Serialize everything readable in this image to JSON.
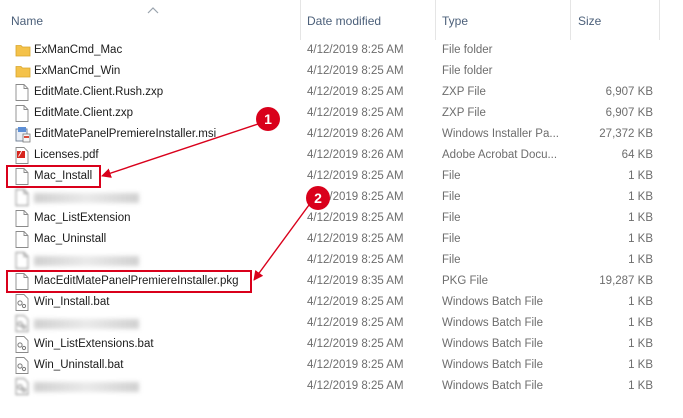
{
  "columns": {
    "name": "Name",
    "date": "Date modified",
    "type": "Type",
    "size": "Size"
  },
  "files": [
    {
      "name": "ExManCmd_Mac",
      "date": "4/12/2019 8:25 AM",
      "type": "File folder",
      "size": "",
      "icon": "folder-icon"
    },
    {
      "name": "ExManCmd_Win",
      "date": "4/12/2019 8:25 AM",
      "type": "File folder",
      "size": "",
      "icon": "folder-icon"
    },
    {
      "name": "EditMate.Client.Rush.zxp",
      "date": "4/12/2019 8:25 AM",
      "type": "ZXP File",
      "size": "6,907 KB",
      "icon": "file-icon"
    },
    {
      "name": "EditMate.Client.zxp",
      "date": "4/12/2019 8:25 AM",
      "type": "ZXP File",
      "size": "6,907 KB",
      "icon": "file-icon"
    },
    {
      "name": "EditMatePanelPremiereInstaller.msi",
      "date": "4/12/2019 8:26 AM",
      "type": "Windows Installer Pa...",
      "size": "27,372 KB",
      "icon": "installer-icon"
    },
    {
      "name": "Licenses.pdf",
      "date": "4/12/2019 8:26 AM",
      "type": "Adobe Acrobat Docu...",
      "size": "64 KB",
      "icon": "pdf-icon"
    },
    {
      "name": "Mac_Install",
      "date": "4/12/2019 8:25 AM",
      "type": "File",
      "size": "1 KB",
      "icon": "file-icon"
    },
    {
      "name": "",
      "date": "4/12/2019 8:25 AM",
      "type": "File",
      "size": "1 KB",
      "icon": "file-icon",
      "blurred": true
    },
    {
      "name": "Mac_ListExtension",
      "date": "4/12/2019 8:25 AM",
      "type": "File",
      "size": "1 KB",
      "icon": "file-icon"
    },
    {
      "name": "Mac_Uninstall",
      "date": "4/12/2019 8:25 AM",
      "type": "File",
      "size": "1 KB",
      "icon": "file-icon"
    },
    {
      "name": "",
      "date": "4/12/2019 8:25 AM",
      "type": "File",
      "size": "1 KB",
      "icon": "file-icon",
      "blurred": true
    },
    {
      "name": "MacEditMatePanelPremiereInstaller.pkg",
      "date": "4/12/2019 8:35 AM",
      "type": "PKG File",
      "size": "19,287 KB",
      "icon": "file-icon"
    },
    {
      "name": "Win_Install.bat",
      "date": "4/12/2019 8:25 AM",
      "type": "Windows Batch File",
      "size": "1 KB",
      "icon": "batch-file-icon"
    },
    {
      "name": "",
      "date": "4/12/2019 8:25 AM",
      "type": "Windows Batch File",
      "size": "1 KB",
      "icon": "batch-file-icon",
      "blurred": true
    },
    {
      "name": "Win_ListExtensions.bat",
      "date": "4/12/2019 8:25 AM",
      "type": "Windows Batch File",
      "size": "1 KB",
      "icon": "batch-file-icon"
    },
    {
      "name": "Win_Uninstall.bat",
      "date": "4/12/2019 8:25 AM",
      "type": "Windows Batch File",
      "size": "1 KB",
      "icon": "batch-file-icon"
    },
    {
      "name": "",
      "date": "4/12/2019 8:25 AM",
      "type": "Windows Batch File",
      "size": "1 KB",
      "icon": "batch-file-icon",
      "blurred": true
    }
  ],
  "annotations": [
    {
      "number": "1",
      "target": "Mac_Install"
    },
    {
      "number": "2",
      "target": "MacEditMatePanelPremiereInstaller.pkg"
    }
  ],
  "colors": {
    "annotation": "#d9001b",
    "folder": "#f4c24a",
    "header_text": "#4c607a"
  }
}
